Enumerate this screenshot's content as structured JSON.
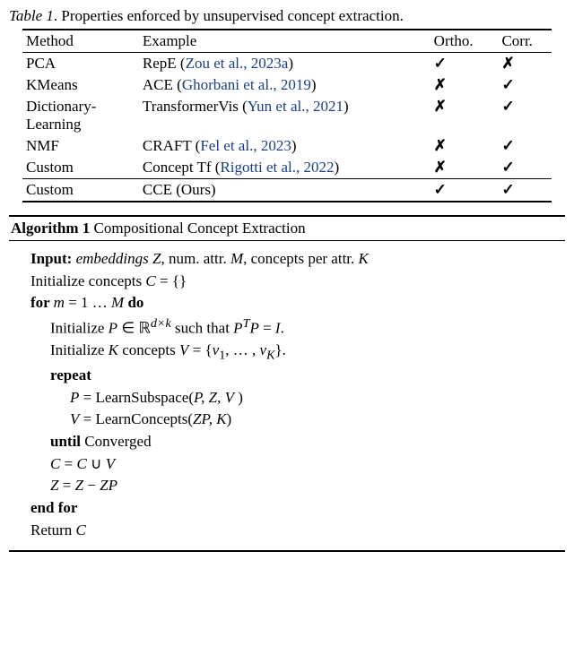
{
  "table": {
    "label": "Table 1",
    "caption_rest": ". Properties enforced by unsupervised concept extraction.",
    "headers": {
      "method": "Method",
      "example": "Example",
      "ortho": "Ortho.",
      "corr": "Corr."
    },
    "rows": [
      {
        "method": "PCA",
        "example_pre": "RepE (",
        "cite": "Zou et al., 2023a",
        "example_post": ")",
        "ortho": "✓",
        "corr": "✗"
      },
      {
        "method": "KMeans",
        "example_pre": "ACE (",
        "cite": "Ghorbani et al., 2019",
        "example_post": ")",
        "ortho": "✗",
        "corr": "✓"
      },
      {
        "method": "Dictionary-Learning",
        "example_pre": "TransformerVis (",
        "cite": "Yun et al., 2021",
        "example_post": ")",
        "ortho": "✗",
        "corr": "✓"
      },
      {
        "method": "NMF",
        "example_pre": "CRAFT (",
        "cite": "Fel et al., 2023",
        "example_post": ")",
        "ortho": "✗",
        "corr": "✓"
      },
      {
        "method": "Custom",
        "example_pre": "Concept Tf (",
        "cite": "Rigotti et al., 2022",
        "example_post": ")",
        "ortho": "✗",
        "corr": "✓"
      }
    ],
    "ours": {
      "method": "Custom",
      "example": "CCE (Ours)",
      "ortho": "✓",
      "corr": "✓"
    }
  },
  "algo": {
    "number": "Algorithm 1",
    "name": " Compositional Concept Extraction",
    "input_label": "Input:",
    "input_rest": " embeddings Z, num. attr. M, concepts per attr. K",
    "l_init_c": "Initialize concepts C = {}",
    "l_for": "for m = 1 … M do",
    "l_init_p_pre": "Initialize P ∈ ℝ",
    "l_init_p_sup": "d×k",
    "l_init_p_mid": " such that P",
    "l_init_p_sup2": "T",
    "l_init_p_post": "P = I.",
    "l_init_v_pre": "Initialize K concepts V = {v",
    "l_init_v_sub1": "1",
    "l_init_v_mid": ", … , v",
    "l_init_v_subK": "K",
    "l_init_v_post": "}.",
    "l_repeat": "repeat",
    "l_p": "P = LearnSubspace(P, Z, V )",
    "l_v": "V = LearnConcepts(ZP, K)",
    "l_until": "until Converged",
    "l_cup": "C = C ∪ V",
    "l_z": "Z = Z − ZP",
    "l_endfor": "end for",
    "l_return": "Return C"
  }
}
